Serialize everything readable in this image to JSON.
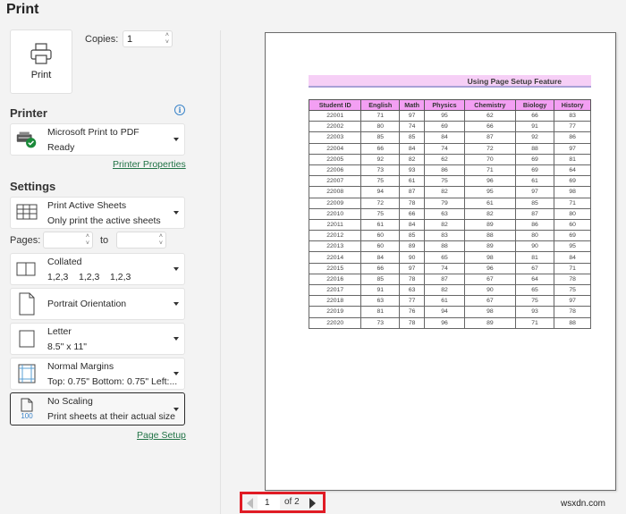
{
  "header": {
    "title": "Print"
  },
  "print_button": {
    "label": "Print",
    "icon": "printer-icon"
  },
  "copies": {
    "label": "Copies:",
    "value": "1"
  },
  "printer": {
    "section_title": "Printer",
    "name": "Microsoft Print to PDF",
    "status": "Ready",
    "properties_link": "Printer Properties"
  },
  "settings": {
    "section_title": "Settings",
    "print_what": {
      "title": "Print Active Sheets",
      "subtitle": "Only print the active sheets"
    },
    "pages": {
      "label": "Pages:",
      "from": "",
      "to_label": "to",
      "to": ""
    },
    "collation": {
      "title": "Collated",
      "subtitle": "1,2,3    1,2,3    1,2,3"
    },
    "orientation": {
      "title": "Portrait Orientation"
    },
    "paper": {
      "title": "Letter",
      "subtitle": "8.5\" x 11\""
    },
    "margins": {
      "title": "Normal Margins",
      "subtitle": "Top: 0.75\" Bottom: 0.75\" Left:..."
    },
    "scaling": {
      "title": "No Scaling",
      "subtitle": "Print sheets at their actual size",
      "icon_text": "100"
    },
    "page_setup_link": "Page Setup"
  },
  "preview": {
    "banner_title": "Using Page Setup Feature",
    "table": {
      "headers": [
        "Student ID",
        "English",
        "Math",
        "Physics",
        "Chemistry",
        "Biology",
        "History"
      ],
      "rows": [
        [
          "22001",
          "71",
          "97",
          "95",
          "62",
          "66",
          "83"
        ],
        [
          "22002",
          "80",
          "74",
          "69",
          "66",
          "91",
          "77"
        ],
        [
          "22003",
          "85",
          "85",
          "84",
          "87",
          "92",
          "86"
        ],
        [
          "22004",
          "66",
          "84",
          "74",
          "72",
          "88",
          "97"
        ],
        [
          "22005",
          "92",
          "82",
          "62",
          "70",
          "69",
          "81"
        ],
        [
          "22006",
          "73",
          "93",
          "86",
          "71",
          "69",
          "64"
        ],
        [
          "22007",
          "75",
          "61",
          "75",
          "96",
          "61",
          "69"
        ],
        [
          "22008",
          "94",
          "87",
          "82",
          "95",
          "97",
          "98"
        ],
        [
          "22009",
          "72",
          "78",
          "79",
          "61",
          "85",
          "71"
        ],
        [
          "22010",
          "75",
          "66",
          "63",
          "82",
          "87",
          "80"
        ],
        [
          "22011",
          "61",
          "84",
          "82",
          "89",
          "86",
          "60"
        ],
        [
          "22012",
          "60",
          "85",
          "83",
          "88",
          "80",
          "69"
        ],
        [
          "22013",
          "60",
          "89",
          "88",
          "89",
          "90",
          "95"
        ],
        [
          "22014",
          "84",
          "90",
          "65",
          "98",
          "81",
          "84"
        ],
        [
          "22015",
          "66",
          "97",
          "74",
          "96",
          "67",
          "71"
        ],
        [
          "22016",
          "85",
          "78",
          "87",
          "67",
          "64",
          "78"
        ],
        [
          "22017",
          "91",
          "63",
          "82",
          "90",
          "65",
          "75"
        ],
        [
          "22018",
          "63",
          "77",
          "61",
          "67",
          "75",
          "97"
        ],
        [
          "22019",
          "81",
          "76",
          "94",
          "98",
          "93",
          "78"
        ],
        [
          "22020",
          "73",
          "78",
          "96",
          "89",
          "71",
          "88"
        ]
      ]
    }
  },
  "page_nav": {
    "current": "1",
    "of_label": "of 2"
  },
  "watermark": "wsxdn.com"
}
